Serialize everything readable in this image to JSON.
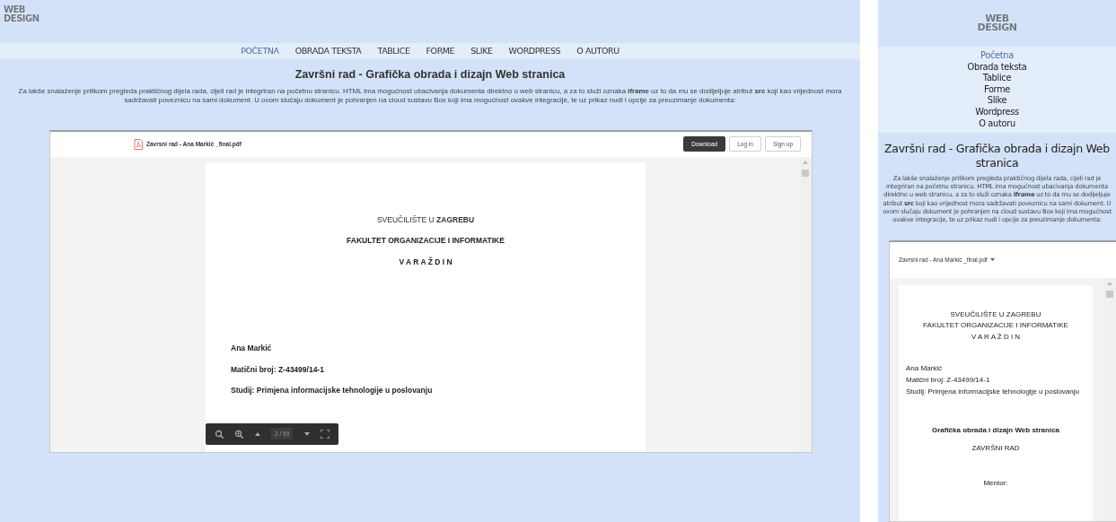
{
  "desktop": {
    "logo": [
      "WEB",
      "DESIGN"
    ],
    "nav": [
      {
        "label": "POČETNA",
        "selected": true
      },
      {
        "label": "OBRADA TEKSTA",
        "selected": false
      },
      {
        "label": "TABLICE",
        "selected": false
      },
      {
        "label": "FORME",
        "selected": false
      },
      {
        "label": "SLIKE",
        "selected": false
      },
      {
        "label": "WORDPRESS",
        "selected": false
      },
      {
        "label": "O AUTORU",
        "selected": false
      }
    ],
    "title": "Završni rad - Grafička obrada i dizajn Web stranica",
    "paragraph": "Za lakše snalaženje prilikom pregleda praktičnog dijela rada, cijeli rad je integriran na početnu stranicu. HTML ima mogućnost ubacivanja dokumenta direktno u web stranicu, a za to služi oznaka **iframe** uz to da mu se dodijeljuje atribut **src** koji kao vrijednost mora sadržavati poveznicu na sami dokument. U ovom slučaju dokument je pohranjen na cloud sustavu Box koji ima mogućnost ovakve integracije, te uz prikaz nudi i opcije za preuzimanje dokumenta:",
    "viewer": {
      "file_name": "Zavrsni rad - Ana Markić _final.pdf",
      "buttons": [
        {
          "label": "Download",
          "kind": "primary"
        },
        {
          "label": "Log in",
          "kind": "outline"
        },
        {
          "label": "Sign up",
          "kind": "outline"
        }
      ],
      "document": [
        {
          "text": "SVEUČILIŠTE U **ZAGREBU**",
          "kind": "heading"
        },
        {
          "text": "FAKULTET ORGANIZACIJE I INFORMATIKE",
          "kind": "heading-bold"
        },
        {
          "text": "V A R A Ž D I N",
          "kind": "heading-bold"
        },
        {
          "text": "Ana Markić",
          "kind": "author"
        },
        {
          "text": "Matični broj: Z-43499/14-1",
          "kind": "author"
        },
        {
          "text": "Studij: Primjena informacijske tehnologije u poslovanju",
          "kind": "author"
        }
      ],
      "page_indicator": "2 / 59"
    }
  },
  "mobile": {
    "logo": [
      "WEB",
      "DESIGN"
    ],
    "nav": [
      {
        "label": "Početna",
        "selected": true
      },
      {
        "label": "Obrada teksta",
        "selected": false
      },
      {
        "label": "Tablice",
        "selected": false
      },
      {
        "label": "Forme",
        "selected": false
      },
      {
        "label": "Slike",
        "selected": false
      },
      {
        "label": "Wordpress",
        "selected": false
      },
      {
        "label": "O autoru",
        "selected": false
      }
    ],
    "title": "Završni rad - Grafička obrada i dizajn Web stranica",
    "paragraph": "Za lakše snalaženje prilikom pregleda praktičnog dijela rada, cijeli rad je integriran na početnu stranicu. HTML ima mogućnost ubacivanja dokumenta direktno u web stranicu, a za to služi oznaka **iframe** uz to da mu se dodijeljuje atribut **src** koji kao vrijednost mora sadržavati poveznicu na sami dokument. U ovom slučaju dokument je pohranjen na cloud sustavu Box koji ima mogućnost ovakve integracije, te uz prikaz nudi i opcije za preuzimanje dokumenta:",
    "viewer": {
      "file_name": "Zavrsni rad - Ana Markić _final.pdf",
      "document": [
        {
          "text": "SVEUČILIŠTE U ZAGREBU",
          "kind": "heading"
        },
        {
          "text": "FAKULTET ORGANIZACIJE I INFORMATIKE",
          "kind": "heading"
        },
        {
          "text": "V A R A Ž D I N",
          "kind": "heading"
        },
        {
          "text": "Ana Markić",
          "kind": "author"
        },
        {
          "text": "Matični broj: Z-43499/14-1",
          "kind": "author"
        },
        {
          "text": "Studij: Primjena informacijske tehnologije u poslovanju",
          "kind": "author"
        },
        {
          "text": "Grafička obrada i dizajn Web stranica",
          "kind": "title"
        },
        {
          "text": "ZAVRŠNI RAD",
          "kind": "subtitle"
        },
        {
          "text": "Mentor:",
          "kind": "mentor"
        }
      ]
    }
  }
}
